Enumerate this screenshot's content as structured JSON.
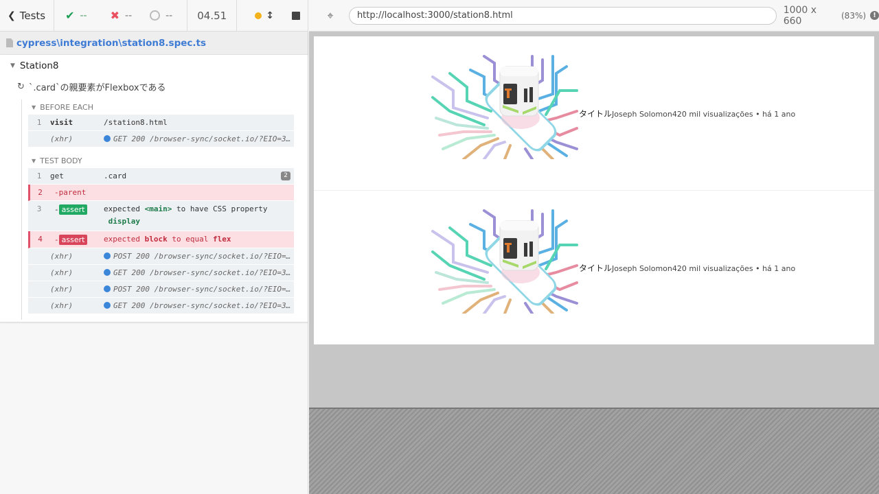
{
  "stats": {
    "tests_label": "Tests",
    "passed": "--",
    "failed": "--",
    "pending": "--",
    "duration": "04.51"
  },
  "spec": {
    "path": "cypress\\integration\\station8.spec.ts"
  },
  "suite": {
    "title": "Station8"
  },
  "test": {
    "title": "`.card`の親要素がFlexboxである"
  },
  "hooks": {
    "before_each_label": "BEFORE EACH",
    "test_body_label": "TEST BODY"
  },
  "before_each": [
    {
      "num": "1",
      "name": "visit",
      "msg": "/station8.html"
    },
    {
      "num": "",
      "name": "(xhr)",
      "msg": "GET 200 /browser-sync/socket.io/?EIO=3&transport=polling"
    }
  ],
  "test_body": {
    "c1": {
      "num": "1",
      "name": "get",
      "msg": ".card",
      "count": "2"
    },
    "c2": {
      "num": "2",
      "name": "-parent"
    },
    "c3": {
      "num": "3",
      "dash": "-",
      "badge": "assert",
      "m1": "expected",
      "m2": "<main>",
      "m3": "to have CSS property",
      "m4": "display"
    },
    "c4": {
      "num": "4",
      "dash": "-",
      "badge": "assert",
      "m1": "expected",
      "m2": "block",
      "m3": "to equal",
      "m4": "flex"
    },
    "xhr": [
      {
        "name": "(xhr)",
        "msg": "POST 200 /browser-sync/socket.io/?EIO=3&transport=polling"
      },
      {
        "name": "(xhr)",
        "msg": "GET 200 /browser-sync/socket.io/?EIO=3&transport=polling"
      },
      {
        "name": "(xhr)",
        "msg": "POST 200 /browser-sync/socket.io/?EIO=3&transport=polling"
      },
      {
        "name": "(xhr)",
        "msg": "GET 200 /browser-sync/socket.io/?EIO=3&transport=polling"
      }
    ]
  },
  "aut": {
    "url": "http://localhost:3000/station8.html",
    "viewport": "1000 x 660",
    "scale": "(83%)"
  },
  "cards": [
    {
      "title": "タイトル",
      "meta": "Joseph Solomon420 mil visualizações • há 1 ano"
    },
    {
      "title": "タイトル",
      "meta": "Joseph Solomon420 mil visualizações • há 1 ano"
    }
  ]
}
